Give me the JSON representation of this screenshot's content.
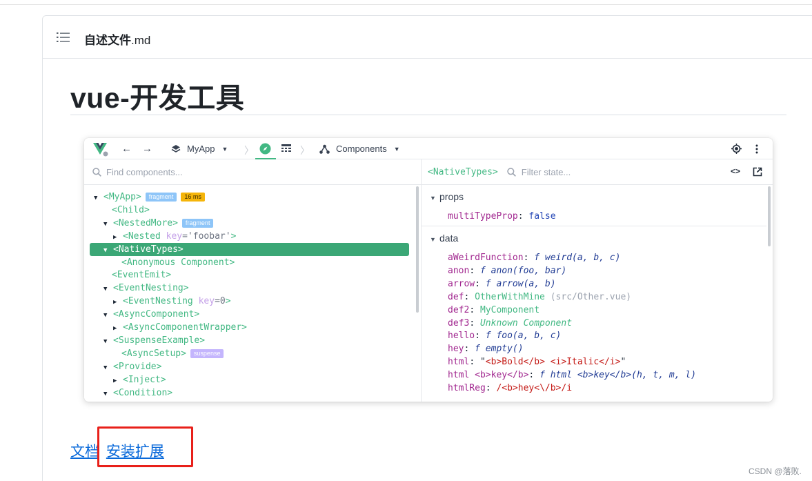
{
  "file": {
    "name": "自述文件",
    "ext": ".md"
  },
  "heading": "vue-开发工具",
  "devtools": {
    "toolbar": {
      "app": "MyApp",
      "components": "Components"
    },
    "left_search": "Find components...",
    "right_selected": "<NativeTypes>",
    "right_search": "Filter state...",
    "tree": [
      {
        "caret": "▼",
        "name": "<MyApp>",
        "badges": [
          {
            "text": "fragment",
            "color": "blue"
          },
          {
            "text": "16 ms",
            "color": "orange"
          }
        ]
      },
      {
        "caret": "",
        "name": "<Child>"
      },
      {
        "caret": "▼",
        "name": "<NestedMore>",
        "badges": [
          {
            "text": "fragment",
            "color": "blue"
          }
        ]
      },
      {
        "caret": "▶",
        "name": "<Nested",
        "attr_key": " key",
        "attr_val": "='foobar'",
        "close": ">"
      },
      {
        "caret": "▼",
        "name": "<NativeTypes>",
        "selected": true
      },
      {
        "caret": "",
        "name": "<Anonymous Component>"
      },
      {
        "caret": "",
        "name": "<EventEmit>"
      },
      {
        "caret": "▼",
        "name": "<EventNesting>"
      },
      {
        "caret": "▶",
        "name": "<EventNesting",
        "attr_key": " key",
        "attr_val": "=0",
        "close": ">"
      },
      {
        "caret": "▼",
        "name": "<AsyncComponent>"
      },
      {
        "caret": "▶",
        "name": "<AsyncComponentWrapper>"
      },
      {
        "caret": "▼",
        "name": "<SuspenseExample>"
      },
      {
        "caret": "",
        "name": "<AsyncSetup>",
        "badges": [
          {
            "text": "suspense",
            "color": "purple"
          }
        ]
      },
      {
        "caret": "▼",
        "name": "<Provide>"
      },
      {
        "caret": "▶",
        "name": "<Inject>"
      },
      {
        "caret": "▼",
        "name": "<Condition>"
      }
    ],
    "props_title": "props",
    "props": [
      {
        "key": "multiTypeProp",
        "parts": [
          {
            "t": "false",
            "c": "blue"
          }
        ]
      }
    ],
    "data_title": "data",
    "data": [
      {
        "key": "aWeirdFunction",
        "parts": [
          {
            "t": "f",
            "c": "fn"
          },
          {
            "t": " weird(a, b, c)",
            "c": "fn"
          }
        ]
      },
      {
        "key": "anon",
        "parts": [
          {
            "t": "f",
            "c": "fn"
          },
          {
            "t": " anon(foo, bar)",
            "c": "fn"
          }
        ]
      },
      {
        "key": "arrow",
        "parts": [
          {
            "t": "f",
            "c": "fn"
          },
          {
            "t": " arrow(a, b)",
            "c": "fn"
          }
        ]
      },
      {
        "key": "def",
        "parts": [
          {
            "t": "OtherWithMine",
            "c": "grn"
          },
          {
            "t": " (src/Other.vue)",
            "c": "gray"
          }
        ]
      },
      {
        "key": "def2",
        "parts": [
          {
            "t": "MyComponent",
            "c": "grn"
          }
        ]
      },
      {
        "key": "def3",
        "parts": [
          {
            "t": "Unknown Component",
            "c": "grni"
          }
        ]
      },
      {
        "key": "hello",
        "parts": [
          {
            "t": "f",
            "c": "fn"
          },
          {
            "t": " foo(a, b, c)",
            "c": "fn"
          }
        ]
      },
      {
        "key": "hey",
        "parts": [
          {
            "t": "f",
            "c": "fn"
          },
          {
            "t": " empty()",
            "c": "fn"
          }
        ]
      },
      {
        "key": "html",
        "parts": [
          {
            "t": "\"",
            "c": "p"
          },
          {
            "t": "<b>Bold</b> <i>Italic</i>",
            "c": "red"
          },
          {
            "t": "\"",
            "c": "p"
          }
        ]
      },
      {
        "key": "html <b>key</b>",
        "parts": [
          {
            "t": "f",
            "c": "fn"
          },
          {
            "t": " html <b>key</b>(h, t, m, l)",
            "c": "fn"
          }
        ]
      },
      {
        "key": "htmlReg",
        "parts": [
          {
            "t": "/<b>hey<\\/b>/i",
            "c": "red"
          }
        ]
      }
    ]
  },
  "links": {
    "docs": "文档",
    "install": "安装扩展"
  },
  "watermark": "CSDN @落败."
}
